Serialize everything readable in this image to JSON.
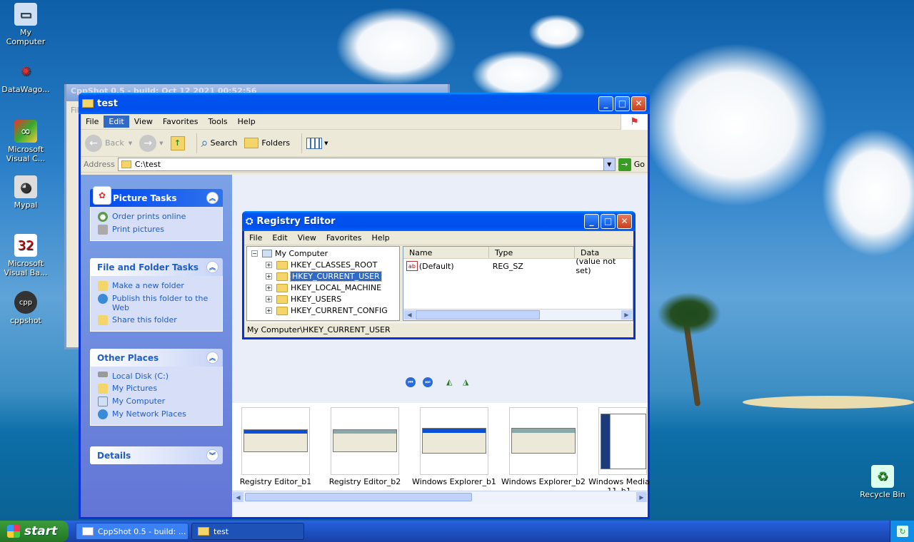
{
  "desktop": {
    "icons": [
      {
        "label": "My Computer"
      },
      {
        "label": "DataWago..."
      },
      {
        "label": "Microsoft Visual C..."
      },
      {
        "label": "Mypal"
      },
      {
        "label": "Microsoft Visual Ba..."
      },
      {
        "label": "cppshot"
      },
      {
        "label": "Recycle Bin"
      }
    ]
  },
  "bg_window": {
    "title": "CppShot 0.5 - build: Oct 12 2021 00:52:56",
    "menu": "Fil"
  },
  "explorer": {
    "title": "test",
    "menu": [
      "File",
      "Edit",
      "View",
      "Favorites",
      "Tools",
      "Help"
    ],
    "toolbar": {
      "back": "Back",
      "search": "Search",
      "folders": "Folders"
    },
    "address": {
      "label": "Address",
      "value": "C:\\test",
      "go": "Go"
    },
    "panels": {
      "picture_tasks": {
        "title": "Picture Tasks",
        "links": [
          "Order prints online",
          "Print pictures"
        ]
      },
      "file_folder_tasks": {
        "title": "File and Folder Tasks",
        "links": [
          "Make a new folder",
          "Publish this folder to the Web",
          "Share this folder"
        ]
      },
      "other_places": {
        "title": "Other Places",
        "links": [
          "Local Disk (C:)",
          "My Pictures",
          "My Computer",
          "My Network Places"
        ]
      },
      "details": {
        "title": "Details"
      }
    },
    "thumbnails": [
      {
        "caption": "Registry Editor_b1"
      },
      {
        "caption": "Registry Editor_b2"
      },
      {
        "caption": "Windows Explorer_b1"
      },
      {
        "caption": "Windows Explorer_b2"
      },
      {
        "caption": "Windows Media 11_b1"
      }
    ]
  },
  "regedit": {
    "title": "Registry Editor",
    "menu": [
      "File",
      "Edit",
      "View",
      "Favorites",
      "Help"
    ],
    "tree": {
      "root": "My Computer",
      "keys": [
        "HKEY_CLASSES_ROOT",
        "HKEY_CURRENT_USER",
        "HKEY_LOCAL_MACHINE",
        "HKEY_USERS",
        "HKEY_CURRENT_CONFIG"
      ],
      "selected": "HKEY_CURRENT_USER"
    },
    "columns": [
      "Name",
      "Type",
      "Data"
    ],
    "rows": [
      {
        "name": "(Default)",
        "type": "REG_SZ",
        "data": "(value not set)"
      }
    ],
    "status": "My Computer\\HKEY_CURRENT_USER"
  },
  "taskbar": {
    "start": "start",
    "tasks": [
      {
        "label": "CppShot 0.5 - build: ..."
      },
      {
        "label": "test"
      }
    ]
  }
}
